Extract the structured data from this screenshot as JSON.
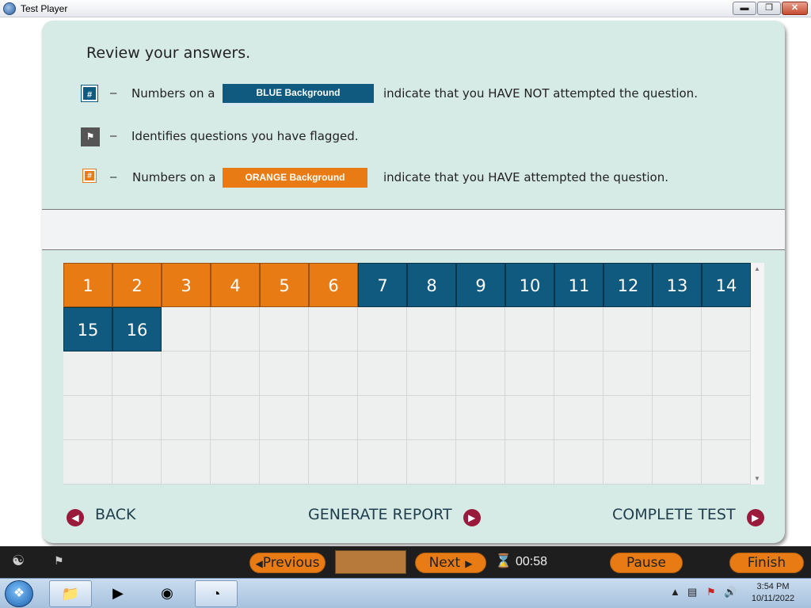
{
  "window": {
    "title": "Test Player"
  },
  "review": {
    "title": "Review your answers.",
    "blue_chip": "#",
    "blue_prefix": "Numbers on a",
    "blue_label": "BLUE Background",
    "blue_suffix": "indicate that you HAVE NOT attempted the question.",
    "flag_text": "Identifies questions you have flagged.",
    "orange_chip": "#",
    "orange_prefix": "Numbers on a",
    "orange_label": "ORANGE Background",
    "orange_suffix": "indicate that you HAVE attempted the question.",
    "dash": "–"
  },
  "questions": [
    {
      "n": "1",
      "state": "attempted"
    },
    {
      "n": "2",
      "state": "attempted"
    },
    {
      "n": "3",
      "state": "attempted"
    },
    {
      "n": "4",
      "state": "attempted"
    },
    {
      "n": "5",
      "state": "attempted"
    },
    {
      "n": "6",
      "state": "attempted"
    },
    {
      "n": "7",
      "state": "not_attempted"
    },
    {
      "n": "8",
      "state": "not_attempted"
    },
    {
      "n": "9",
      "state": "not_attempted"
    },
    {
      "n": "10",
      "state": "not_attempted"
    },
    {
      "n": "11",
      "state": "not_attempted"
    },
    {
      "n": "12",
      "state": "not_attempted"
    },
    {
      "n": "13",
      "state": "not_attempted"
    },
    {
      "n": "14",
      "state": "not_attempted"
    },
    {
      "n": "15",
      "state": "not_attempted"
    },
    {
      "n": "16",
      "state": "not_attempted"
    }
  ],
  "nav": {
    "back": "BACK",
    "generate_report": "GENERATE REPORT",
    "complete_test": "COMPLETE TEST"
  },
  "toolbar": {
    "previous": "Previous",
    "next": "Next",
    "timer": "00:58",
    "pause": "Pause",
    "finish": "Finish"
  },
  "taskbar": {
    "time": "3:54 PM",
    "date": "10/11/2022"
  },
  "colors": {
    "blue": "#0f5a7e",
    "orange": "#e87b14",
    "card": "#d7ebe6",
    "accent": "#9a1a3c"
  }
}
